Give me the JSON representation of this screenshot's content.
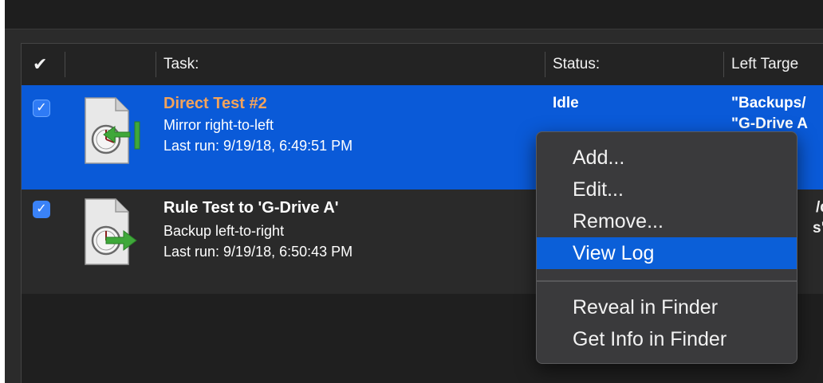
{
  "table": {
    "headers": {
      "check": "✔",
      "task": "Task:",
      "status": "Status:",
      "left_target": "Left Targe"
    },
    "rows": [
      {
        "checked": "✓",
        "title": "Direct Test #2",
        "title_color": "#f4a35a",
        "mode": "Mirror right-to-left",
        "last_run": "Last run: 9/19/18, 6:49:51 PM",
        "status": "Idle",
        "left_target_1": "\"Backups/",
        "left_target_2": "\"G-Drive A",
        "icon": "sync-document-arrow-left-icon"
      },
      {
        "checked": "✓",
        "title": "Rule Test to 'G-Drive A'",
        "title_color": "#ffffff",
        "mode": "Backup left-to-right",
        "last_run": "Last run: 9/19/18, 6:50:43 PM",
        "status": "",
        "left_target_1": "/dp",
        "left_target_2": "s\" c",
        "icon": "sync-document-arrow-right-icon"
      }
    ]
  },
  "context_menu": {
    "items": [
      "Add...",
      "Edit...",
      "Remove...",
      "View Log",
      "Reveal in Finder",
      "Get Info in Finder"
    ],
    "highlighted": "View Log"
  },
  "colors": {
    "selection": "#0a5ad8",
    "menu_highlight": "#0b5fd8",
    "accent_title": "#f4a35a"
  }
}
